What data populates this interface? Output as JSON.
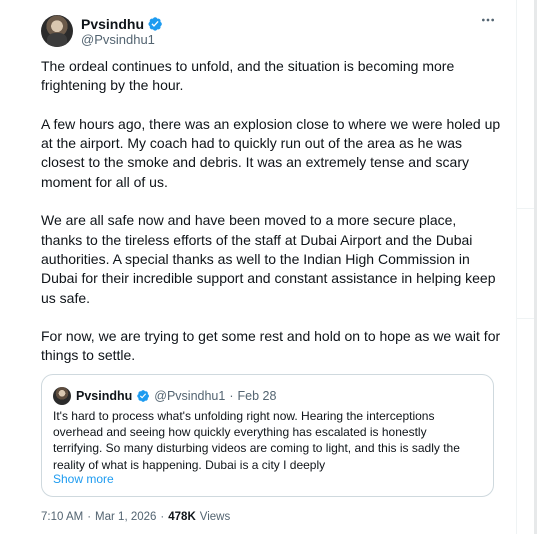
{
  "tweet": {
    "display_name": "Pvsindhu",
    "handle": "@Pvsindhu1",
    "paragraphs": [
      "The ordeal continues to unfold, and the situation is becoming more frightening by the hour.",
      "A few hours ago, there was an explosion close to where we were holed up at the airport. My coach had to quickly run out of the area as he was closest to the smoke and debris. It was an extremely tense and scary moment for all of us.",
      "We are all safe now and have been moved to a more secure place, thanks to the tireless efforts of the staff at Dubai Airport and the Dubai authorities. A special thanks as well to the Indian High Commission in Dubai for their incredible support and constant assistance in helping keep us safe.",
      "For now, we are trying to get some rest and hold on to hope as we wait for things to settle."
    ],
    "time": "7:10 AM",
    "date": "Mar 1, 2026",
    "views_count": "478K",
    "views_label": "Views",
    "separator": "·"
  },
  "quote": {
    "display_name": "Pvsindhu",
    "handle": "@Pvsindhu1",
    "separator": "·",
    "date": "Feb 28",
    "lines": [
      "It's hard to process what's unfolding right now. Hearing the interceptions",
      "overhead and seeing how quickly everything has escalated is honestly",
      "terrifying. So many disturbing videos are coming to light, and this is sadly the",
      "reality of what is happening. Dubai is a city I deeply"
    ],
    "show_more": "Show more"
  },
  "icons": {
    "verified": "verified-badge-icon",
    "more": "more-horizontal-icon"
  },
  "colors": {
    "accent": "#1d9bf0",
    "text": "#0f1419",
    "secondary": "#536471",
    "border": "#cfd9de"
  }
}
